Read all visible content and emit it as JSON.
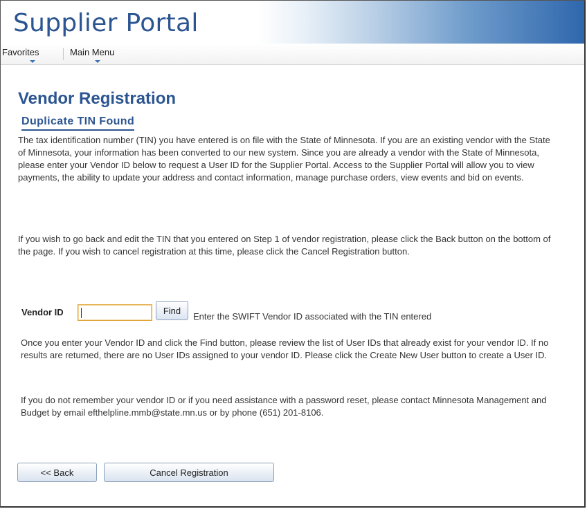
{
  "header": {
    "portal_title": "Supplier Portal"
  },
  "nav": {
    "favorites": "Favorites",
    "main_menu": "Main Menu"
  },
  "page": {
    "title": "Vendor Registration",
    "subtitle": "Duplicate TIN Found",
    "intro": "The tax identification number (TIN) you have entered is on file with the State of Minnesota. If you are an existing vendor with the State of Minnesota, your information has been converted to our new system. Since you are already a vendor with the State of Minnesota, please enter your Vendor ID below to request a User ID for the Supplier Portal. Access to the Supplier Portal will allow you to view payments, the ability to update your address and contact information, manage purchase orders, view events and bid on events.",
    "back_info": "If you wish to go back and edit the TIN that you entered on Step 1 of vendor registration, please click the Back button on the bottom of the page. If you wish to cancel registration at this time, please click the Cancel Registration button."
  },
  "vendor_lookup": {
    "label": "Vendor ID",
    "value": "",
    "find_button": "Find",
    "hint": "Enter the SWIFT Vendor ID associated with the TIN entered"
  },
  "instructions": {
    "find_info": "Once you enter your Vendor ID and click the Find button, please review the list of User IDs that already exist for your vendor ID. If no results are returned, there are no User IDs assigned to your vendor ID. Please click the Create New User button to create a User ID.",
    "help_info": "If you do not remember your vendor ID or if you need assistance with a password reset, please contact Minnesota Management and Budget by email efthelpline.mmb@state.mn.us or by phone (651) 201-8106."
  },
  "buttons": {
    "back": "<< Back",
    "cancel": "Cancel Registration"
  },
  "colors": {
    "brand_blue": "#2b5591",
    "input_focus": "#e0a236"
  }
}
